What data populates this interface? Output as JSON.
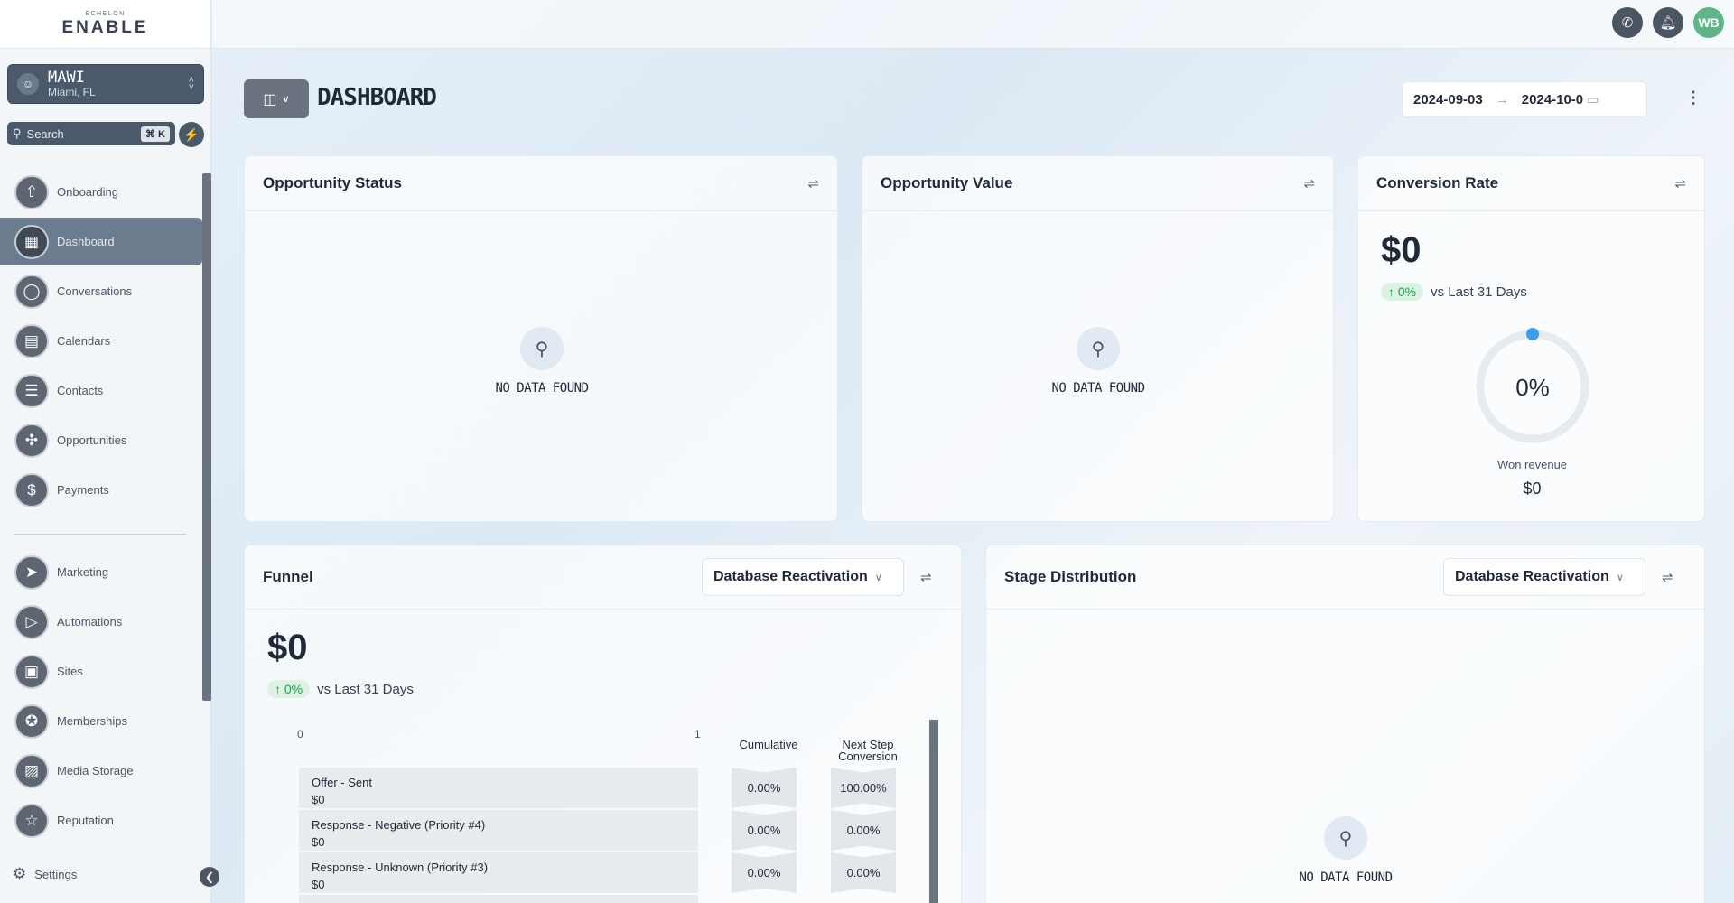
{
  "brand": {
    "small": "ECHELON",
    "main": "ENABLE"
  },
  "location": {
    "name": "MAWI",
    "city": "Miami, FL"
  },
  "search": {
    "placeholder": "Search",
    "shortcut": "⌘ K"
  },
  "nav": {
    "items": [
      {
        "label": "Onboarding",
        "icon": "rocket-icon"
      },
      {
        "label": "Dashboard",
        "icon": "dashboard-icon",
        "active": true
      },
      {
        "label": "Conversations",
        "icon": "chat-icon"
      },
      {
        "label": "Calendars",
        "icon": "calendar-icon"
      },
      {
        "label": "Contacts",
        "icon": "contacts-icon"
      },
      {
        "label": "Opportunities",
        "icon": "opportunities-icon"
      },
      {
        "label": "Payments",
        "icon": "payments-icon"
      },
      {
        "label": "Marketing",
        "icon": "send-icon"
      },
      {
        "label": "Automations",
        "icon": "play-icon"
      },
      {
        "label": "Sites",
        "icon": "sites-icon"
      },
      {
        "label": "Memberships",
        "icon": "badge-icon"
      },
      {
        "label": "Media Storage",
        "icon": "image-icon"
      },
      {
        "label": "Reputation",
        "icon": "star-icon"
      }
    ],
    "settings_label": "Settings"
  },
  "topbar": {
    "avatar_initials": "WB"
  },
  "header": {
    "title": "DASHBOARD",
    "date_start": "2024-09-03",
    "date_end": "2024-10-0"
  },
  "cards": {
    "opportunity_status": {
      "title": "Opportunity Status",
      "empty": "NO DATA FOUND"
    },
    "opportunity_value": {
      "title": "Opportunity Value",
      "empty": "NO DATA FOUND"
    },
    "conversion_rate": {
      "title": "Conversion Rate",
      "amount": "$0",
      "change": "↑ 0%",
      "comparison": "vs Last 31 Days",
      "gauge_value": "0%",
      "won_label": "Won revenue",
      "won_amount": "$0"
    },
    "funnel": {
      "title": "Funnel",
      "pipeline": "Database Reactivation",
      "amount": "$0",
      "change": "↑ 0%",
      "comparison": "vs Last 31 Days",
      "axis_min": "0",
      "axis_max": "1",
      "col_cumulative": "Cumulative",
      "col_next_step_1": "Next Step",
      "col_next_step_2": "Conversion",
      "rows": [
        {
          "stage": "Offer - Sent",
          "value": "$0",
          "cumulative": "0.00%",
          "next": "100.00%"
        },
        {
          "stage": "Response - Negative (Priority #4)",
          "value": "$0",
          "cumulative": "0.00%",
          "next": "0.00%"
        },
        {
          "stage": "Response - Unknown (Priority #3)",
          "value": "$0",
          "cumulative": "0.00%",
          "next": "0.00%"
        }
      ]
    },
    "stage_distribution": {
      "title": "Stage Distribution",
      "pipeline": "Database Reactivation",
      "empty": "NO DATA FOUND"
    }
  },
  "colors": {
    "accent": "#4b5563",
    "positive": "#16a34a",
    "gauge_dot": "#3b9ee8",
    "avatar": "#5fb587"
  }
}
